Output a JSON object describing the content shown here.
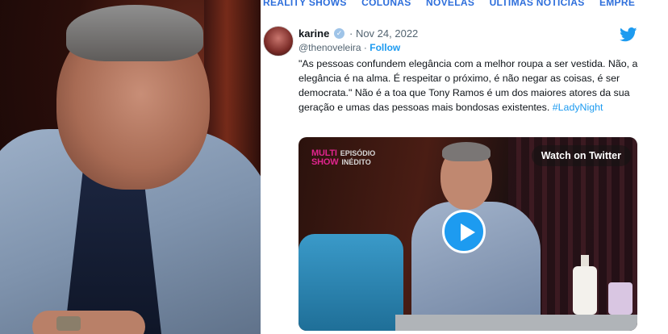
{
  "nav": {
    "items": [
      "REALITY SHOWS",
      "COLUNAS",
      "NOVELAS",
      "ÚLTIMAS NOTÍCIAS",
      "EMPRE"
    ]
  },
  "tweet": {
    "author_name": "karine",
    "date": "· Nov 24, 2022",
    "handle": "@thenoveleira",
    "separator": " · ",
    "follow_label": "Follow",
    "text": "\"As pessoas confundem elegância com a melhor roupa a ser vestida. Não, a elegância é na alma. É respeitar o próximo, é não negar as coisas, é ser democrata.\" Não é a toa que Tony Ramos é um dos maiores atores da sua geração e umas das pessoas mais bondosas existentes. ",
    "hashtag": "#LadyNight",
    "video": {
      "logo_line1": "MULTI",
      "logo_line1b": "EPISÓDIO",
      "logo_line2": "SHOW",
      "logo_line2b": "INÉDITO",
      "watch_label": "Watch on Twitter"
    }
  },
  "icons": {
    "twitter": "twitter-bird-icon",
    "verified": "verified-badge-icon",
    "play": "play-icon"
  },
  "colors": {
    "twitter_blue": "#1d9bf0",
    "nav_blue": "#2d6edb"
  }
}
